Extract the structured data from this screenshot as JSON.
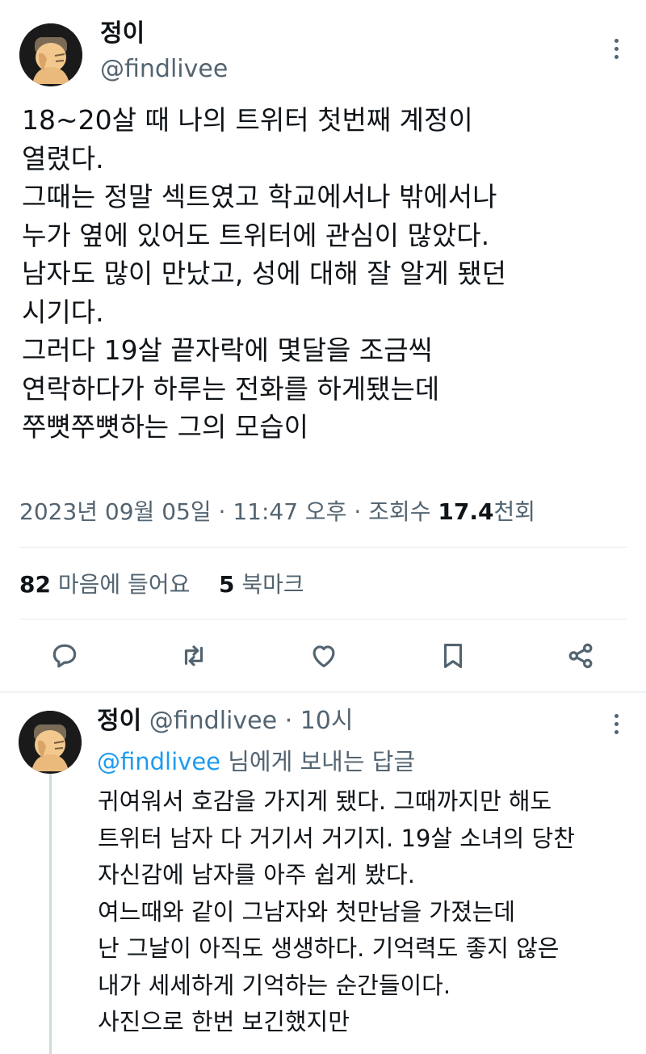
{
  "tweet": {
    "author_name": "정이",
    "author_handle": "@findlivee",
    "lines": [
      "18~20살 때 나의 트위터 첫번째 계정이",
      "열렸다.",
      "그때는 정말 섹트였고 학교에서나 밖에서나",
      "누가 옆에 있어도 트위터에 관심이 많았다.",
      "남자도 많이 만났고, 성에 대해 잘 알게 됐던",
      "시기다.",
      "그러다 19살 끝자락에 몇달을 조금씩",
      "연락하다가 하루는 전화를 하게됐는데",
      "쭈뼛쭈뼛하는 그의 모습이"
    ],
    "date": "2023년 09월 05일",
    "time": "11:47 오후",
    "views_label": "조회수",
    "views_value": "17.4",
    "views_unit": "천회",
    "likes_count": "82",
    "likes_label": "마음에 들어요",
    "bookmarks_count": "5",
    "bookmarks_label": "북마크"
  },
  "reply": {
    "author_name": "정이",
    "author_handle": "@findlivee",
    "time_ago": "10시",
    "replying_mention": "@findlivee",
    "replying_suffix": "님에게 보내는 답글",
    "lines": [
      "귀여워서 호감을 가지게 됐다. 그때까지만 해도",
      "트위터 남자 다 거기서 거기지. 19살 소녀의 당찬",
      "자신감에 남자를 아주 쉽게 봤다.",
      "여느때와 같이 그남자와 첫만남을 가졌는데",
      "난 그날이 아직도 생생하다. 기억력도 좋지 않은",
      "내가 세세하게 기억하는 순간들이다.",
      "사진으로 한번 보긴했지만"
    ]
  },
  "icons": {
    "reply": "comment-icon",
    "retweet": "retweet-icon",
    "like": "heart-icon",
    "bookmark": "bookmark-icon",
    "share": "share-icon",
    "more": "more-icon"
  },
  "colors": {
    "text": "#0f1419",
    "secondary": "#536471",
    "accent": "#1d9bf0",
    "divider": "#eff3f4"
  }
}
